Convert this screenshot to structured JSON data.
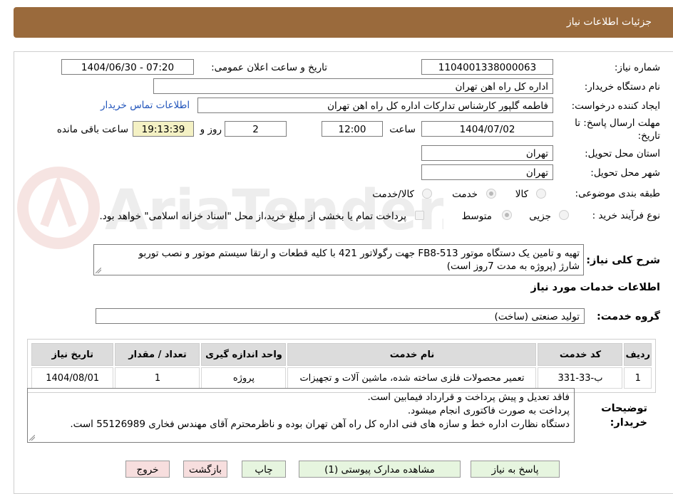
{
  "header": {
    "title": "جزئیات اطلاعات نیاز"
  },
  "watermark": {
    "text": "AriaTender.neT"
  },
  "fields": {
    "need_number_label": "شماره نیاز:",
    "need_number": "1104001338000063",
    "announce_label": "تاریخ و ساعت اعلان عمومی:",
    "announce_value": "1404/06/30 - 07:20",
    "buyer_org_label": "نام دستگاه خریدار:",
    "buyer_org": "اداره کل راه اهن تهران",
    "creator_label": "ایجاد کننده درخواست:",
    "creator": "فاطمه گلپور کارشناس تدارکات اداره کل راه اهن تهران",
    "contact_link": "اطلاعات تماس خریدار",
    "deadline_label_1": "مهلت ارسال پاسخ: تا",
    "deadline_label_2": "تاریخ:",
    "deadline_date": "1404/07/02",
    "time_label": "ساعت",
    "deadline_time": "12:00",
    "days_value": "2",
    "days_label": "روز و",
    "remaining_time": "19:13:39",
    "remaining_label": "ساعت باقی مانده",
    "province_label": "استان محل تحویل:",
    "province": "تهران",
    "city_label": "شهر محل تحویل:",
    "city": "تهران",
    "category_label": "طبقه بندی موضوعی:",
    "category_options": [
      "کالا",
      "خدمت",
      "کالا/خدمت"
    ],
    "category_selected": "خدمت",
    "process_label": "نوع فرآیند خرید :",
    "process_options": [
      "جزیی",
      "متوسط"
    ],
    "process_selected": "متوسط",
    "payment_note": "پرداخت تمام یا بخشی از مبلغ خرید،از محل \"اسناد خزانه اسلامی\" خواهد بود."
  },
  "description": {
    "label": "شرح کلی نیاز:",
    "line1": "تهیه و تامین یک دستگاه موتور FB8-513 جهت رگولاتور 421 با کلیه قطعات و ارتقا سیستم موتور و نصب توربو",
    "line2": "شارژ (پروژه به مدت 7روز است)"
  },
  "services": {
    "section_title": "اطلاعات خدمات مورد نیاز",
    "group_label": "گروه خدمت:",
    "group_value": "تولید صنعتی (ساخت)",
    "columns": [
      "ردیف",
      "کد خدمت",
      "نام خدمت",
      "واحد اندازه گیری",
      "تعداد / مقدار",
      "تاریخ نیاز"
    ],
    "rows": [
      {
        "row": "1",
        "code": "ب-33-331",
        "name": "تعمیر محصولات فلزی ساخته شده، ماشین آلات و تجهیزات",
        "unit": "پروژه",
        "qty": "1",
        "date": "1404/08/01"
      }
    ]
  },
  "buyer_notes": {
    "label_1": "توضیحات",
    "label_2": "خریدار:",
    "line1": "فاقد تعدیل و پیش پرداخت و قرارداد فیمابین است.",
    "line2": "پرداخت به صورت فاکتوری انجام میشود.",
    "line3": "دستگاه نظارت اداره خط و سازه های فنی اداره کل راه آهن تهران بوده و ناظرمحترم آقای مهندس فخاری 55126989 است."
  },
  "buttons": {
    "reply": "پاسخ به نیاز",
    "view_docs": "مشاهده مدارک پیوستی (1)",
    "print": "چاپ",
    "back": "بازگشت",
    "exit": "خروج"
  }
}
